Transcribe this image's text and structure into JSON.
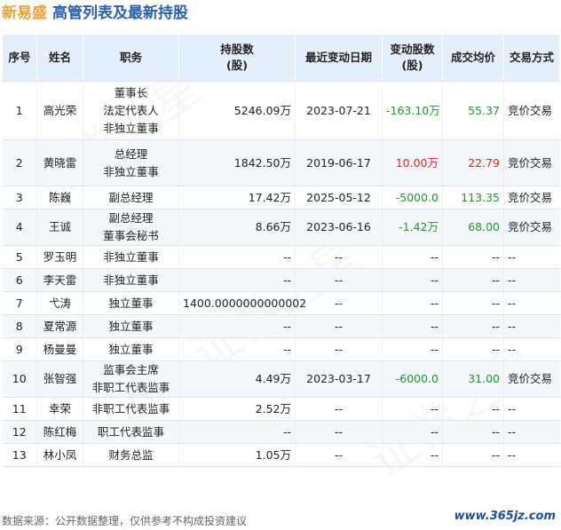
{
  "title": {
    "company": "新易盛",
    "subtitle": "高管列表及最新持股"
  },
  "headers": {
    "seq": "序号",
    "name": "姓名",
    "position": "职务",
    "shares_line1": "持股数",
    "shares_line2": "(股)",
    "date": "最近变动日期",
    "change_line1": "变动股数",
    "change_line2": "(股)",
    "price": "成交均价",
    "method": "交易方式"
  },
  "rows": [
    {
      "seq": "1",
      "name": "高光荣",
      "positions": [
        "董事长",
        "法定代表人",
        "非独立董事"
      ],
      "shares": "5246.09万",
      "date": "2023-07-21",
      "change": "-163.10万",
      "price": "55.37",
      "method": "竞价交易",
      "dir": "neg"
    },
    {
      "seq": "2",
      "name": "黄晓雷",
      "positions": [
        "总经理",
        "非独立董事"
      ],
      "shares": "1842.50万",
      "date": "2019-06-17",
      "change": "10.00万",
      "price": "22.79",
      "method": "竞价交易",
      "dir": "pos"
    },
    {
      "seq": "3",
      "name": "陈巍",
      "positions": [
        "副总经理"
      ],
      "shares": "17.42万",
      "date": "2025-05-12",
      "change": "-5000.0",
      "price": "113.35",
      "method": "竞价交易",
      "dir": "neg"
    },
    {
      "seq": "4",
      "name": "王诚",
      "positions": [
        "副总经理",
        "董事会秘书"
      ],
      "shares": "8.66万",
      "date": "2023-06-16",
      "change": "-1.42万",
      "price": "68.00",
      "method": "竞价交易",
      "dir": "neg"
    },
    {
      "seq": "5",
      "name": "罗玉明",
      "positions": [
        "非独立董事"
      ],
      "shares": "--",
      "date": "--",
      "change": "--",
      "price": "--",
      "method": "--",
      "dir": ""
    },
    {
      "seq": "6",
      "name": "李天雷",
      "positions": [
        "非独立董事"
      ],
      "shares": "--",
      "date": "--",
      "change": "--",
      "price": "--",
      "method": "--",
      "dir": ""
    },
    {
      "seq": "7",
      "name": "弋涛",
      "positions": [
        "独立董事"
      ],
      "shares": "1400.0000000000002",
      "date": "--",
      "change": "--",
      "price": "--",
      "method": "--",
      "dir": ""
    },
    {
      "seq": "8",
      "name": "夏常源",
      "positions": [
        "独立董事"
      ],
      "shares": "--",
      "date": "--",
      "change": "--",
      "price": "--",
      "method": "--",
      "dir": ""
    },
    {
      "seq": "9",
      "name": "杨曼曼",
      "positions": [
        "独立董事"
      ],
      "shares": "--",
      "date": "--",
      "change": "--",
      "price": "--",
      "method": "--",
      "dir": ""
    },
    {
      "seq": "10",
      "name": "张智强",
      "positions": [
        "监事会主席",
        "非职工代表监事"
      ],
      "shares": "4.49万",
      "date": "2023-03-17",
      "change": "-6000.0",
      "price": "31.00",
      "method": "竞价交易",
      "dir": "neg"
    },
    {
      "seq": "11",
      "name": "幸荣",
      "positions": [
        "非职工代表监事"
      ],
      "shares": "2.52万",
      "date": "--",
      "change": "--",
      "price": "--",
      "method": "--",
      "dir": ""
    },
    {
      "seq": "12",
      "name": "陈红梅",
      "positions": [
        "职工代表监事"
      ],
      "shares": "--",
      "date": "--",
      "change": "--",
      "price": "--",
      "method": "--",
      "dir": ""
    },
    {
      "seq": "13",
      "name": "林小凤",
      "positions": [
        "财务总监"
      ],
      "shares": "1.05万",
      "date": "--",
      "change": "--",
      "price": "--",
      "method": "--",
      "dir": ""
    }
  ],
  "footer": {
    "source": "数据来源：公开数据整理，仅供参考不构成投资建议",
    "site": "www.365jz.com"
  },
  "watermark": "证券之星",
  "colors": {
    "accent": "#f2a130",
    "title_blue": "#2a5fb0",
    "header_bg": "#e5eefb",
    "up": "#e0261d",
    "down": "#1a9a2c"
  }
}
